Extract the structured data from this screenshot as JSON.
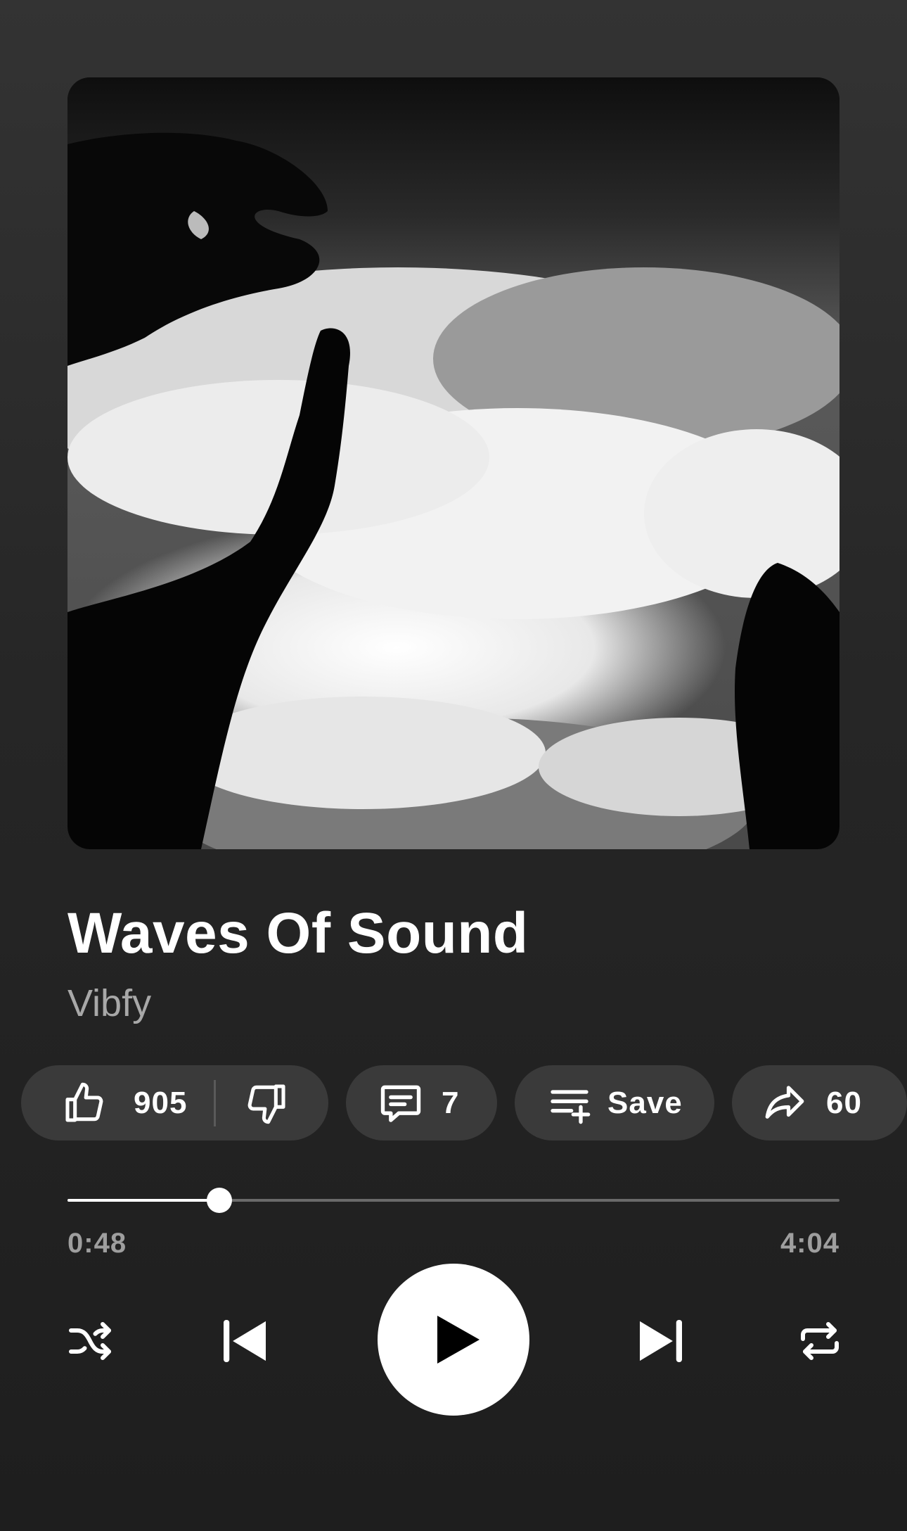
{
  "song": {
    "title": "Waves Of Sound",
    "artist": "Vibfy"
  },
  "actions": {
    "like_count": "905",
    "comment_count": "7",
    "save_label": "Save",
    "share_count": "60"
  },
  "playback": {
    "elapsed": "0:48",
    "duration": "4:04",
    "progress_fraction": 0.197
  },
  "controls": {
    "shuffle": "shuffle-icon",
    "previous": "skip-previous-icon",
    "play": "play-icon",
    "next": "skip-next-icon",
    "repeat": "repeat-icon"
  },
  "colors": {
    "background_top": "#333333",
    "background_bottom": "#1e1e1e",
    "pill": "#3a3a3a",
    "secondary_text": "#a8a8a8",
    "accent": "#ffffff"
  }
}
